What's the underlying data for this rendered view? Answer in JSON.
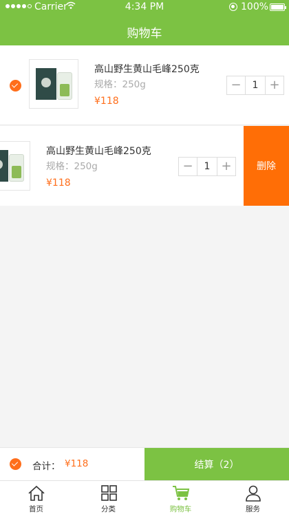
{
  "status_bar": {
    "carrier": "Carrier",
    "time": "4:34 PM",
    "battery": "100%"
  },
  "nav": {
    "title": "购物车"
  },
  "cart": {
    "items": [
      {
        "name": "高山野生黄山毛峰250克",
        "spec": "规格：250g",
        "price": "¥118",
        "quantity": "1",
        "checked": true
      },
      {
        "name": "高山野生黄山毛峰250克",
        "spec": "规格：250g",
        "price": "¥118",
        "quantity": "1",
        "delete_label": "删除"
      }
    ]
  },
  "checkout": {
    "total_label": "合计：",
    "total_value": "¥118",
    "settle_label": "结算（2）"
  },
  "tabbar": {
    "tabs": [
      {
        "label": "首页",
        "icon": "home-icon"
      },
      {
        "label": "分类",
        "icon": "grid-icon"
      },
      {
        "label": "购物车",
        "icon": "cart-icon",
        "active": true
      },
      {
        "label": "服务",
        "icon": "user-icon"
      }
    ]
  },
  "colors": {
    "brand_green": "#7cc243",
    "accent_orange": "#ff6e1b",
    "delete_orange": "#ff6e06"
  }
}
